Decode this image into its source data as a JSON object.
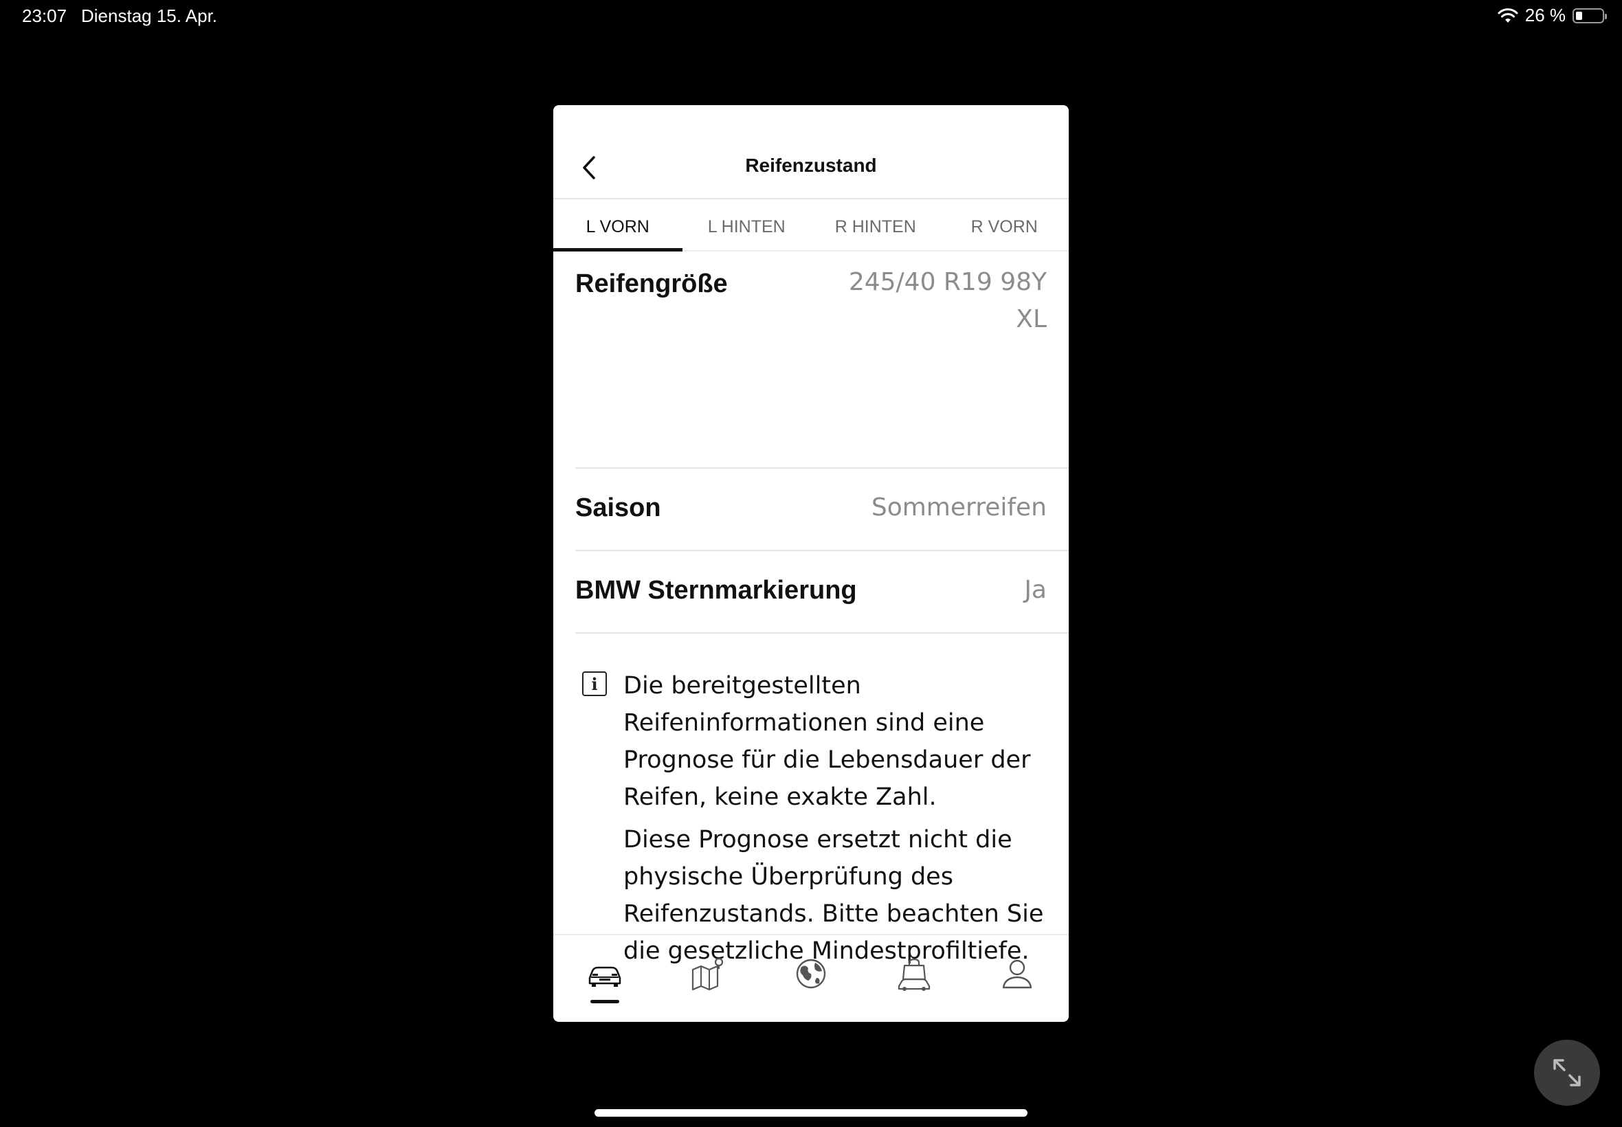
{
  "status_bar": {
    "time": "23:07",
    "date": "Dienstag 15. Apr.",
    "battery": "26 %"
  },
  "header": {
    "title": "Reifenzustand"
  },
  "tabs": [
    {
      "label": "L VORN",
      "active": true
    },
    {
      "label": "L HINTEN",
      "active": false
    },
    {
      "label": "R HINTEN",
      "active": false
    },
    {
      "label": "R VORN",
      "active": false
    }
  ],
  "details": [
    {
      "label": "Reifengröße",
      "value_line1": "245/40 R19 98Y",
      "value_line2": "XL"
    },
    {
      "label": "Saison",
      "value": "Sommerreifen"
    },
    {
      "label": "BMW Sternmarkierung",
      "value": "Ja"
    }
  ],
  "info": {
    "paragraph1": "Die bereitgestellten Reifeninformationen sind eine Prognose für die Lebensdauer der Reifen, keine exakte Zahl.",
    "paragraph2": "Diese Prognose ersetzt nicht die physische Überprüfung des Reifenzustands. Bitte beachten Sie die gesetzliche Mindestprofiltiefe."
  },
  "bottom_nav": [
    {
      "icon": "car-icon",
      "active": true
    },
    {
      "icon": "map-icon",
      "active": false
    },
    {
      "icon": "globe-icon",
      "active": false
    },
    {
      "icon": "shop-icon",
      "active": false
    },
    {
      "icon": "profile-icon",
      "active": false
    }
  ],
  "colors": {
    "background": "#000000",
    "surface": "#ffffff",
    "value_text": "#8c8c8c",
    "divider": "#e6e6e6"
  }
}
